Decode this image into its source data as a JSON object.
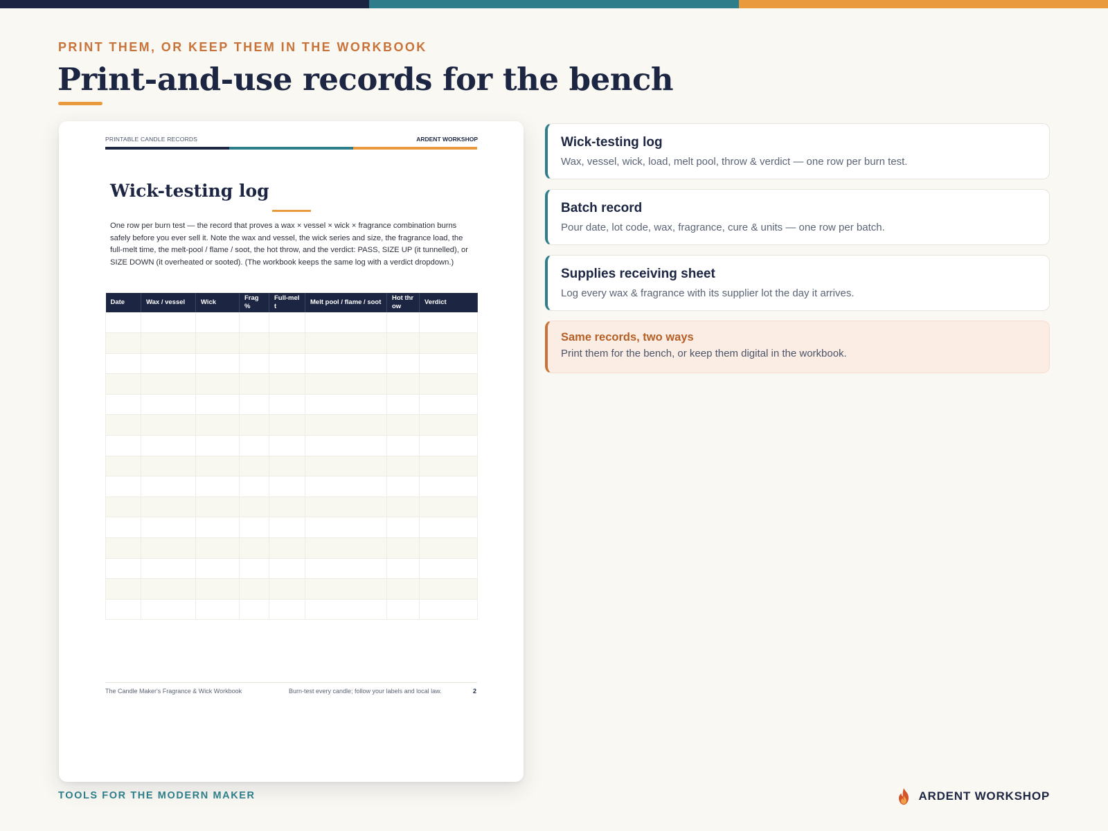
{
  "colors": {
    "navy": "#1c2541",
    "teal": "#2d7d8a",
    "orange": "#e89a3c",
    "rust": "#c8733a",
    "background": "#faf8f2"
  },
  "header": {
    "eyebrow": "PRINT THEM, OR KEEP THEM IN THE WORKBOOK",
    "title": "Print-and-use records for the bench"
  },
  "document": {
    "header_left": "PRINTABLE CANDLE RECORDS",
    "header_right": "ARDENT WORKSHOP",
    "title": "Wick-testing log",
    "body": "One row per burn test — the record that proves a wax × vessel × wick × fragrance combination burns safely before you ever sell it. Note the wax and vessel, the wick series and size, the fragrance load, the full-melt time, the melt-pool / flame / soot, the hot throw, and the verdict: PASS, SIZE UP (it tunnelled), or SIZE DOWN (it overheated or sooted). (The workbook keeps the same log with a verdict dropdown.)",
    "table": {
      "columns": [
        "Date",
        "Wax / vessel",
        "Wick",
        "Frag %",
        "Full-melt",
        "Melt pool / flame / soot",
        "Hot throw",
        "Verdict"
      ],
      "empty_rows": 15
    },
    "footer": {
      "left": "The Candle Maker's Fragrance & Wick Workbook",
      "middle": "Burn-test every candle; follow your labels and local law.",
      "page": "2"
    }
  },
  "cards": [
    {
      "title": "Wick-testing log",
      "description": "Wax, vessel, wick, load, melt pool, throw & verdict — one row per burn test."
    },
    {
      "title": "Batch record",
      "description": "Pour date, lot code, wax, fragrance, cure & units — one row per batch."
    },
    {
      "title": "Supplies receiving sheet",
      "description": "Log every wax & fragrance with its supplier lot the day it arrives."
    }
  ],
  "note": {
    "title": "Same records, two ways",
    "description": "Print them for the bench, or keep them digital in the workbook."
  },
  "footer": {
    "tagline": "TOOLS FOR THE MODERN MAKER",
    "brand": "ARDENT WORKSHOP",
    "brand_icon": "flame-icon"
  }
}
